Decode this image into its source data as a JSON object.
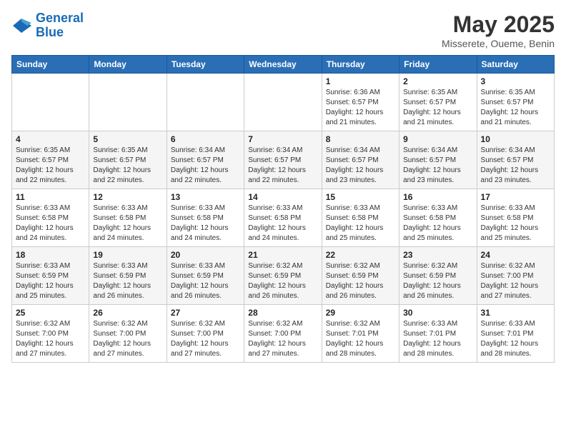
{
  "logo": {
    "line1": "General",
    "line2": "Blue"
  },
  "title": "May 2025",
  "subtitle": "Misserete, Oueme, Benin",
  "days_header": [
    "Sunday",
    "Monday",
    "Tuesday",
    "Wednesday",
    "Thursday",
    "Friday",
    "Saturday"
  ],
  "weeks": [
    [
      {
        "day": "",
        "info": ""
      },
      {
        "day": "",
        "info": ""
      },
      {
        "day": "",
        "info": ""
      },
      {
        "day": "",
        "info": ""
      },
      {
        "day": "1",
        "info": "Sunrise: 6:36 AM\nSunset: 6:57 PM\nDaylight: 12 hours\nand 21 minutes."
      },
      {
        "day": "2",
        "info": "Sunrise: 6:35 AM\nSunset: 6:57 PM\nDaylight: 12 hours\nand 21 minutes."
      },
      {
        "day": "3",
        "info": "Sunrise: 6:35 AM\nSunset: 6:57 PM\nDaylight: 12 hours\nand 21 minutes."
      }
    ],
    [
      {
        "day": "4",
        "info": "Sunrise: 6:35 AM\nSunset: 6:57 PM\nDaylight: 12 hours\nand 22 minutes."
      },
      {
        "day": "5",
        "info": "Sunrise: 6:35 AM\nSunset: 6:57 PM\nDaylight: 12 hours\nand 22 minutes."
      },
      {
        "day": "6",
        "info": "Sunrise: 6:34 AM\nSunset: 6:57 PM\nDaylight: 12 hours\nand 22 minutes."
      },
      {
        "day": "7",
        "info": "Sunrise: 6:34 AM\nSunset: 6:57 PM\nDaylight: 12 hours\nand 22 minutes."
      },
      {
        "day": "8",
        "info": "Sunrise: 6:34 AM\nSunset: 6:57 PM\nDaylight: 12 hours\nand 23 minutes."
      },
      {
        "day": "9",
        "info": "Sunrise: 6:34 AM\nSunset: 6:57 PM\nDaylight: 12 hours\nand 23 minutes."
      },
      {
        "day": "10",
        "info": "Sunrise: 6:34 AM\nSunset: 6:57 PM\nDaylight: 12 hours\nand 23 minutes."
      }
    ],
    [
      {
        "day": "11",
        "info": "Sunrise: 6:33 AM\nSunset: 6:58 PM\nDaylight: 12 hours\nand 24 minutes."
      },
      {
        "day": "12",
        "info": "Sunrise: 6:33 AM\nSunset: 6:58 PM\nDaylight: 12 hours\nand 24 minutes."
      },
      {
        "day": "13",
        "info": "Sunrise: 6:33 AM\nSunset: 6:58 PM\nDaylight: 12 hours\nand 24 minutes."
      },
      {
        "day": "14",
        "info": "Sunrise: 6:33 AM\nSunset: 6:58 PM\nDaylight: 12 hours\nand 24 minutes."
      },
      {
        "day": "15",
        "info": "Sunrise: 6:33 AM\nSunset: 6:58 PM\nDaylight: 12 hours\nand 25 minutes."
      },
      {
        "day": "16",
        "info": "Sunrise: 6:33 AM\nSunset: 6:58 PM\nDaylight: 12 hours\nand 25 minutes."
      },
      {
        "day": "17",
        "info": "Sunrise: 6:33 AM\nSunset: 6:58 PM\nDaylight: 12 hours\nand 25 minutes."
      }
    ],
    [
      {
        "day": "18",
        "info": "Sunrise: 6:33 AM\nSunset: 6:59 PM\nDaylight: 12 hours\nand 25 minutes."
      },
      {
        "day": "19",
        "info": "Sunrise: 6:33 AM\nSunset: 6:59 PM\nDaylight: 12 hours\nand 26 minutes."
      },
      {
        "day": "20",
        "info": "Sunrise: 6:33 AM\nSunset: 6:59 PM\nDaylight: 12 hours\nand 26 minutes."
      },
      {
        "day": "21",
        "info": "Sunrise: 6:32 AM\nSunset: 6:59 PM\nDaylight: 12 hours\nand 26 minutes."
      },
      {
        "day": "22",
        "info": "Sunrise: 6:32 AM\nSunset: 6:59 PM\nDaylight: 12 hours\nand 26 minutes."
      },
      {
        "day": "23",
        "info": "Sunrise: 6:32 AM\nSunset: 6:59 PM\nDaylight: 12 hours\nand 26 minutes."
      },
      {
        "day": "24",
        "info": "Sunrise: 6:32 AM\nSunset: 7:00 PM\nDaylight: 12 hours\nand 27 minutes."
      }
    ],
    [
      {
        "day": "25",
        "info": "Sunrise: 6:32 AM\nSunset: 7:00 PM\nDaylight: 12 hours\nand 27 minutes."
      },
      {
        "day": "26",
        "info": "Sunrise: 6:32 AM\nSunset: 7:00 PM\nDaylight: 12 hours\nand 27 minutes."
      },
      {
        "day": "27",
        "info": "Sunrise: 6:32 AM\nSunset: 7:00 PM\nDaylight: 12 hours\nand 27 minutes."
      },
      {
        "day": "28",
        "info": "Sunrise: 6:32 AM\nSunset: 7:00 PM\nDaylight: 12 hours\nand 27 minutes."
      },
      {
        "day": "29",
        "info": "Sunrise: 6:32 AM\nSunset: 7:01 PM\nDaylight: 12 hours\nand 28 minutes."
      },
      {
        "day": "30",
        "info": "Sunrise: 6:33 AM\nSunset: 7:01 PM\nDaylight: 12 hours\nand 28 minutes."
      },
      {
        "day": "31",
        "info": "Sunrise: 6:33 AM\nSunset: 7:01 PM\nDaylight: 12 hours\nand 28 minutes."
      }
    ]
  ]
}
